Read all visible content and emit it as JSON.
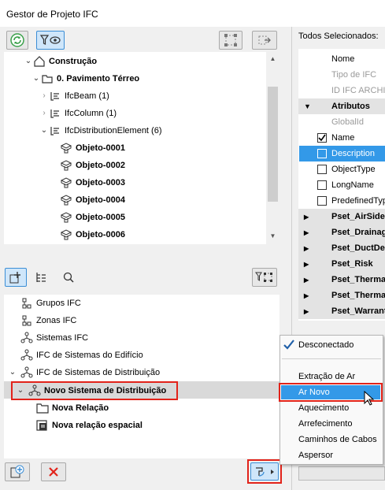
{
  "window": {
    "title": "Gestor de Projeto IFC"
  },
  "tree": {
    "items": [
      {
        "label": "Construção"
      },
      {
        "label": "0. Pavimento Térreo"
      },
      {
        "label": "IfcBeam (1)"
      },
      {
        "label": "IfcColumn (1)"
      },
      {
        "label": "IfcDistributionElement (6)"
      },
      {
        "label": "Objeto-0001"
      },
      {
        "label": "Objeto-0002"
      },
      {
        "label": "Objeto-0003"
      },
      {
        "label": "Objeto-0004"
      },
      {
        "label": "Objeto-0005"
      },
      {
        "label": "Objeto-0006"
      }
    ]
  },
  "systems": {
    "items": [
      {
        "label": "Grupos IFC"
      },
      {
        "label": "Zonas IFC"
      },
      {
        "label": "Sistemas IFC"
      },
      {
        "label": "IFC de Sistemas do Edifício"
      },
      {
        "label": "IFC de Sistemas de Distribuição"
      },
      {
        "label": "Novo Sistema de Distribuição"
      },
      {
        "label": "Nova Relação"
      },
      {
        "label": "Nova relação espacial"
      }
    ]
  },
  "properties": {
    "header": "Todos Selecionados: ",
    "rows": [
      {
        "label": "Nome"
      },
      {
        "label": "Tipo de IFC"
      },
      {
        "label": "ID IFC ARCHICAD"
      },
      {
        "label": "Atributos"
      },
      {
        "label": "GlobalId"
      },
      {
        "label": "Name"
      },
      {
        "label": "Description"
      },
      {
        "label": "ObjectType"
      },
      {
        "label": "LongName"
      },
      {
        "label": "PredefinedType"
      },
      {
        "label": "Pset_AirSideSystemInformation"
      },
      {
        "label": "Pset_DrainageSystem"
      },
      {
        "label": "Pset_DuctDesignCriteria"
      },
      {
        "label": "Pset_Risk"
      },
      {
        "label": "Pset_ThermalLoad"
      },
      {
        "label": "Pset_ThermalLoadAggregate"
      },
      {
        "label": "Pset_Warranty"
      }
    ]
  },
  "menu": {
    "items": [
      {
        "label": "Desconectado"
      },
      {
        "label": "Extração de Ar"
      },
      {
        "label": "Ar Novo"
      },
      {
        "label": "Aquecimento"
      },
      {
        "label": "Arrefecimento"
      },
      {
        "label": "Caminhos de Cabos"
      },
      {
        "label": "Aspersor"
      }
    ]
  },
  "colors": {
    "selection": "#3399e8",
    "highlight_border": "#e2231a",
    "accent": "#3b8ed6"
  }
}
